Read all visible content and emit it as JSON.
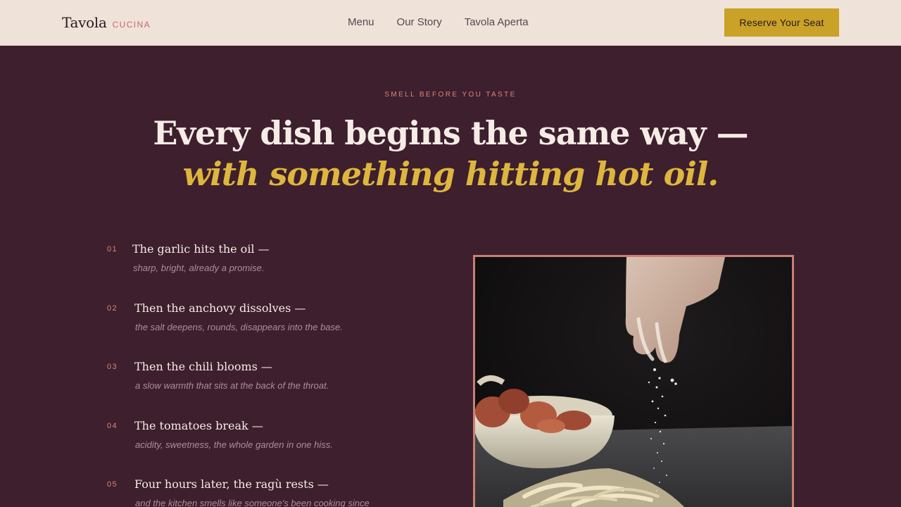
{
  "header": {
    "brand_name": "Tavola",
    "brand_sub": "CUCINA",
    "nav": [
      "Menu",
      "Our Story",
      "Tavola Aperta"
    ],
    "cta_label": "Reserve Your Seat"
  },
  "hero": {
    "eyebrow": "SMELL BEFORE YOU TASTE",
    "headline_line1": "Every dish begins the same way —",
    "headline_line2": "with something hitting hot oil."
  },
  "steps": [
    {
      "num": "01",
      "title": "The garlic hits the oil —",
      "desc": "sharp, bright, already a promise."
    },
    {
      "num": "02",
      "title": "Then the anchovy dissolves —",
      "desc": "the salt deepens, rounds, disappears into the base."
    },
    {
      "num": "03",
      "title": "Then the chili blooms —",
      "desc": "a slow warmth that sits at the back of the throat."
    },
    {
      "num": "04",
      "title": "The tomatoes break —",
      "desc": "acidity, sweetness, the whole garden in one hiss."
    },
    {
      "num": "05",
      "title": "Four hours later, the ragù rests —",
      "desc": "and the kitchen smells like someone's been cooking since"
    }
  ],
  "colors": {
    "background": "#3e1f2d",
    "header_bg": "#efe2d9",
    "accent_gold": "#c9a227",
    "accent_pink": "#d8867a"
  }
}
